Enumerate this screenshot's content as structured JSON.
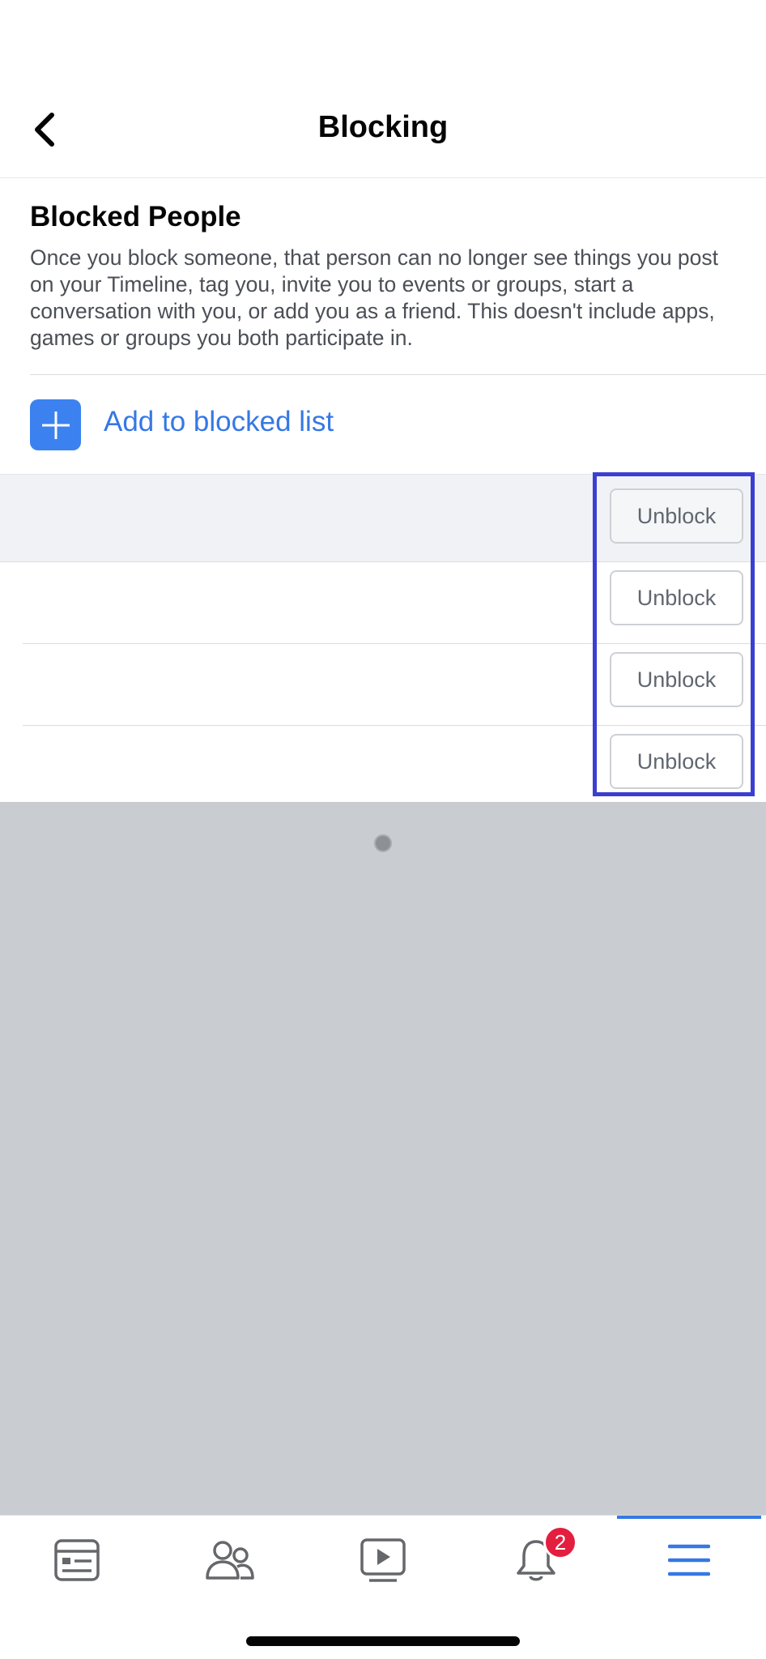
{
  "header": {
    "title": "Blocking"
  },
  "blocked_people": {
    "title": "Blocked People",
    "description": "Once you block someone, that person can no longer see things you post on your Timeline, tag you, invite you to events or groups, start a conversation with you, or add you as a friend. This doesn't include apps, games or groups you both participate in.",
    "add_label": "Add to blocked list",
    "rows": [
      {
        "button_label": "Unblock"
      },
      {
        "button_label": "Unblock"
      },
      {
        "button_label": "Unblock"
      },
      {
        "button_label": "Unblock"
      }
    ]
  },
  "tab_bar": {
    "tabs": [
      {
        "icon": "news-feed-icon"
      },
      {
        "icon": "friends-icon"
      },
      {
        "icon": "watch-icon"
      },
      {
        "icon": "notifications-icon",
        "badge": "2"
      },
      {
        "icon": "menu-icon",
        "active": true
      }
    ]
  },
  "colors": {
    "accent": "#3578e5",
    "add_icon_bg": "#3b82f0",
    "highlight": "#3b3fd1",
    "badge": "#e41e3f",
    "overlay": "#c9ccd1"
  }
}
